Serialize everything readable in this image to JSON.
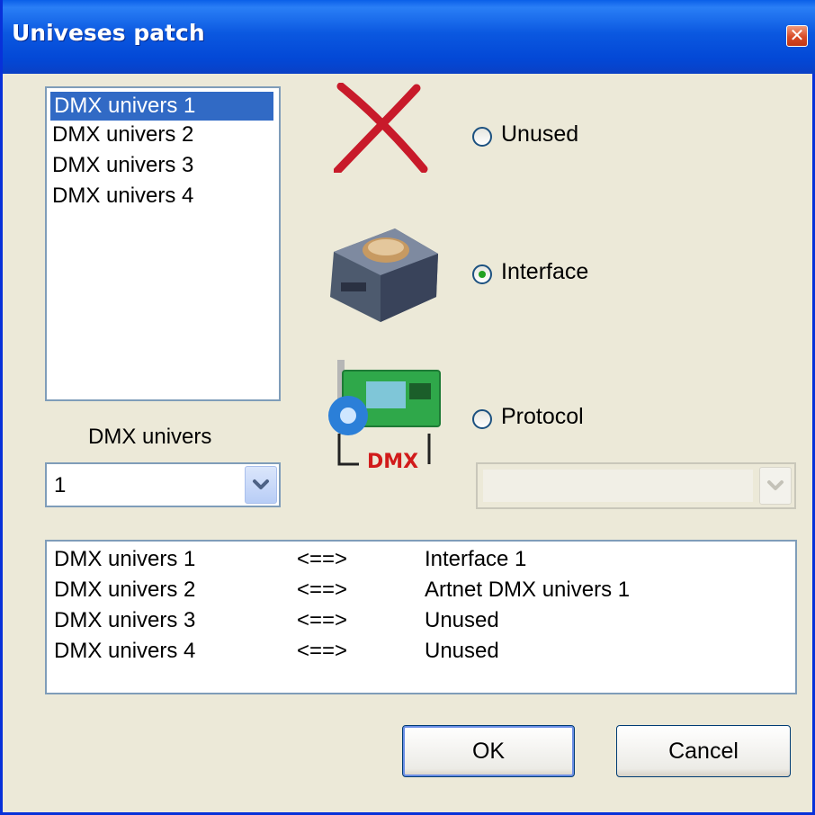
{
  "window": {
    "title": "Univeses patch",
    "close_glyph": "✕"
  },
  "universe_list": {
    "items": [
      "DMX univers 1",
      "DMX univers 2",
      "DMX univers 3",
      "DMX univers 4"
    ],
    "selected_index": 0
  },
  "dmx_univers_label": "DMX univers",
  "dmx_univers_combo": {
    "value": "1"
  },
  "options": {
    "unused": {
      "label": "Unused",
      "checked": false,
      "icon": "red-x-icon"
    },
    "interface": {
      "label": "Interface",
      "checked": true,
      "icon": "usb-dmx-interface-icon"
    },
    "protocol": {
      "label": "Protocol",
      "checked": false,
      "icon": "dmx-protocol-card-icon",
      "icon_text": "DMX"
    }
  },
  "protocol_combo": {
    "value": "",
    "enabled": false
  },
  "patch_list": {
    "rows": [
      {
        "universe": "DMX univers 1",
        "arrow": "<==>",
        "target": "Interface 1"
      },
      {
        "universe": "DMX univers 2",
        "arrow": "<==>",
        "target": "Artnet DMX univers 1"
      },
      {
        "universe": "DMX univers 3",
        "arrow": "<==>",
        "target": "Unused"
      },
      {
        "universe": "DMX univers 4",
        "arrow": "<==>",
        "target": "Unused"
      }
    ]
  },
  "buttons": {
    "ok": "OK",
    "cancel": "Cancel"
  },
  "colors": {
    "title_bar": "#0348d6",
    "selection": "#316ac5",
    "dialog_bg": "#ece9d8",
    "radio_dot": "#21a121"
  }
}
